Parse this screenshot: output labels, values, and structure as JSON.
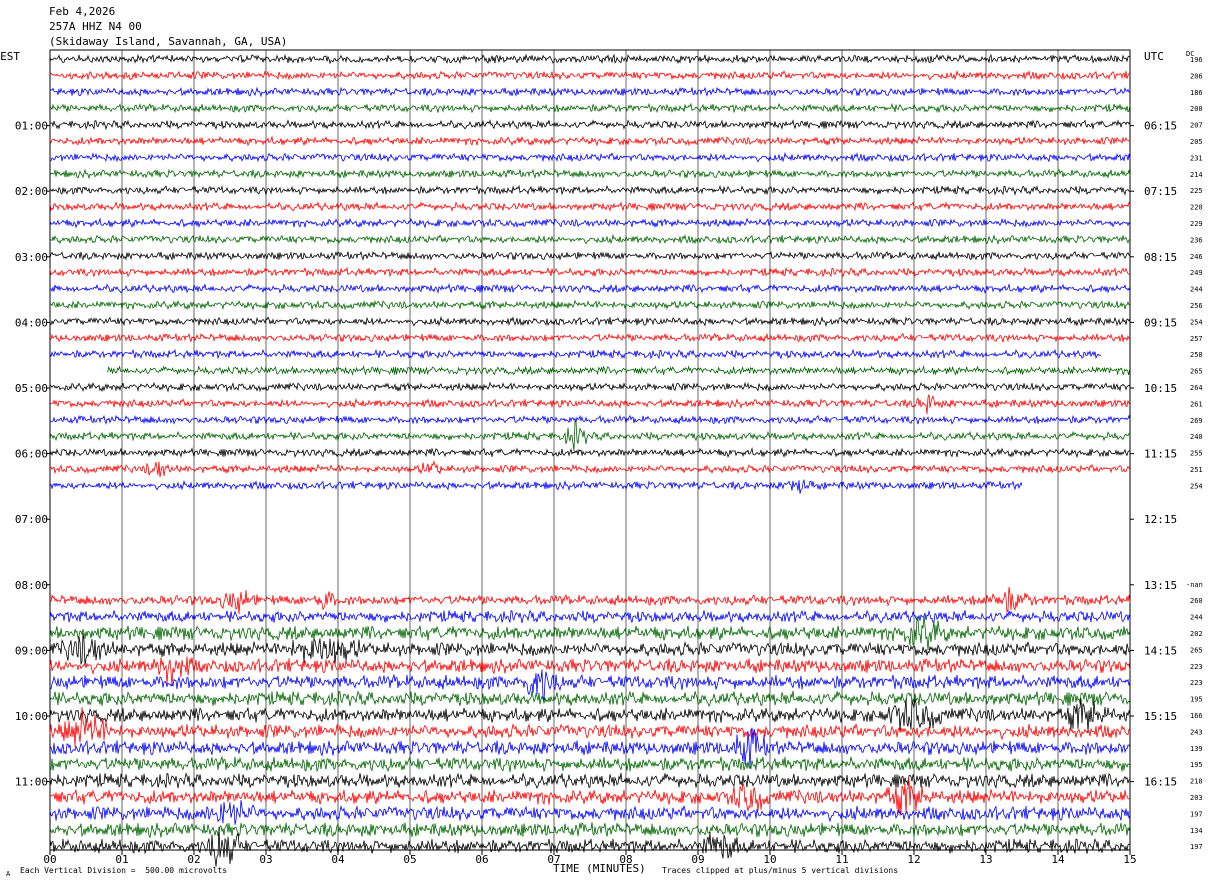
{
  "header": {
    "date": "Feb 4,2026",
    "station": "257A HHZ N4 00",
    "location": "(Skidaway Island, Savannah, GA, USA)"
  },
  "footer": {
    "scale_note": "Each Vertical Division =  500.00 microvolts",
    "clip_note": "Traces clipped at plus/minus 5 vertical divisions",
    "corner_mark": "A"
  },
  "chart_data": {
    "type": "line",
    "title": "",
    "xlabel": "TIME (MINUTES)",
    "x_ticks": [
      "00",
      "01",
      "02",
      "03",
      "04",
      "05",
      "06",
      "07",
      "08",
      "09",
      "10",
      "11",
      "12",
      "13",
      "14",
      "15"
    ],
    "xlim": [
      0,
      15
    ],
    "left_axis_label": "EST",
    "right_axis_label": "UTC",
    "dc_label": "DC",
    "left_time_labels": [
      "01:00",
      "02:00",
      "03:00",
      "04:00",
      "05:00",
      "06:00",
      "07:00",
      "08:00",
      "09:00",
      "10:00",
      "11:00"
    ],
    "right_time_labels": [
      "06:15",
      "07:15",
      "08:15",
      "09:15",
      "10:15",
      "11:15",
      "12:15",
      "13:15",
      "14:15",
      "15:15",
      "16:15"
    ],
    "colors": {
      "black": "#000000",
      "red": "#ff0000",
      "blue": "#0000ff",
      "green": "#006600"
    },
    "color_cycle": [
      "black",
      "red",
      "blue",
      "green"
    ],
    "grid": "vertical lines every minute",
    "gap_label": "-nan",
    "rows": [
      {
        "row": 0,
        "dc": "196",
        "start": 0,
        "end": 15,
        "amp": 1.0
      },
      {
        "row": 1,
        "dc": "206",
        "start": 0,
        "end": 15,
        "amp": 1.0
      },
      {
        "row": 2,
        "dc": "186",
        "start": 0,
        "end": 15,
        "amp": 1.0
      },
      {
        "row": 3,
        "dc": "200",
        "start": 0,
        "end": 15,
        "amp": 1.0
      },
      {
        "row": 4,
        "dc": "207",
        "start": 0,
        "end": 15,
        "amp": 1.0
      },
      {
        "row": 5,
        "dc": "205",
        "start": 0,
        "end": 15,
        "amp": 1.0
      },
      {
        "row": 6,
        "dc": "231",
        "start": 0,
        "end": 15,
        "amp": 1.0
      },
      {
        "row": 7,
        "dc": "214",
        "start": 0,
        "end": 15,
        "amp": 1.0
      },
      {
        "row": 8,
        "dc": "225",
        "start": 0,
        "end": 15,
        "amp": 1.0
      },
      {
        "row": 9,
        "dc": "220",
        "start": 0,
        "end": 15,
        "amp": 1.0
      },
      {
        "row": 10,
        "dc": "229",
        "start": 0,
        "end": 15,
        "amp": 1.0
      },
      {
        "row": 11,
        "dc": "236",
        "start": 0,
        "end": 15,
        "amp": 1.0
      },
      {
        "row": 12,
        "dc": "246",
        "start": 0,
        "end": 15,
        "amp": 1.0
      },
      {
        "row": 13,
        "dc": "249",
        "start": 0,
        "end": 15,
        "amp": 1.0
      },
      {
        "row": 14,
        "dc": "244",
        "start": 0,
        "end": 15,
        "amp": 1.0
      },
      {
        "row": 15,
        "dc": "256",
        "start": 0,
        "end": 15,
        "amp": 1.0
      },
      {
        "row": 16,
        "dc": "254",
        "start": 0,
        "end": 15,
        "amp": 1.0
      },
      {
        "row": 17,
        "dc": "257",
        "start": 0,
        "end": 15,
        "amp": 1.0
      },
      {
        "row": 18,
        "dc": "258",
        "start": 0,
        "end": 14.6,
        "amp": 1.0
      },
      {
        "row": 19,
        "dc": "265",
        "start": 0.8,
        "end": 15,
        "amp": 1.0
      },
      {
        "row": 20,
        "dc": "264",
        "start": 0,
        "end": 15,
        "amp": 1.0
      },
      {
        "row": 21,
        "dc": "261",
        "start": 0,
        "end": 15,
        "amp": 1.0
      },
      {
        "row": 22,
        "dc": "269",
        "start": 0,
        "end": 15,
        "amp": 1.0
      },
      {
        "row": 23,
        "dc": "240",
        "start": 0,
        "end": 15,
        "amp": 1.0
      },
      {
        "row": 24,
        "dc": "255",
        "start": 0,
        "end": 15,
        "amp": 1.0
      },
      {
        "row": 25,
        "dc": "251",
        "start": 0,
        "end": 15,
        "amp": 1.0
      },
      {
        "row": 26,
        "dc": "254",
        "start": 0,
        "end": 13.5,
        "amp": 1.0
      },
      {
        "row": 27,
        "dc": "",
        "start": 0,
        "end": 0,
        "amp": 0
      },
      {
        "row": 28,
        "dc": "",
        "start": 0,
        "end": 0,
        "amp": 0
      },
      {
        "row": 29,
        "dc": "",
        "start": 0,
        "end": 0,
        "amp": 0
      },
      {
        "row": 30,
        "dc": "",
        "start": 0,
        "end": 0,
        "amp": 0
      },
      {
        "row": 31,
        "dc": "",
        "start": 0,
        "end": 0,
        "amp": 0
      },
      {
        "row": 32,
        "dc": "-nan",
        "start": 0,
        "end": 0,
        "amp": 0
      },
      {
        "row": 33,
        "dc": "260",
        "start": 0,
        "end": 15,
        "amp": 1.3
      },
      {
        "row": 34,
        "dc": "244",
        "start": 0,
        "end": 15,
        "amp": 1.5
      },
      {
        "row": 35,
        "dc": "202",
        "start": 0,
        "end": 15,
        "amp": 1.8
      },
      {
        "row": 36,
        "dc": "265",
        "start": 0,
        "end": 15,
        "amp": 1.8
      },
      {
        "row": 37,
        "dc": "223",
        "start": 0,
        "end": 15,
        "amp": 1.8
      },
      {
        "row": 38,
        "dc": "223",
        "start": 0,
        "end": 15,
        "amp": 1.8
      },
      {
        "row": 39,
        "dc": "195",
        "start": 0,
        "end": 15,
        "amp": 1.8
      },
      {
        "row": 40,
        "dc": "166",
        "start": 0,
        "end": 15,
        "amp": 1.8
      },
      {
        "row": 41,
        "dc": "243",
        "start": 0,
        "end": 15,
        "amp": 1.8
      },
      {
        "row": 42,
        "dc": "139",
        "start": 0,
        "end": 15,
        "amp": 1.8
      },
      {
        "row": 43,
        "dc": "195",
        "start": 0,
        "end": 15,
        "amp": 1.8
      },
      {
        "row": 44,
        "dc": "218",
        "start": 0,
        "end": 15,
        "amp": 1.8
      },
      {
        "row": 45,
        "dc": "203",
        "start": 0,
        "end": 15,
        "amp": 1.8
      },
      {
        "row": 46,
        "dc": "197",
        "start": 0,
        "end": 15,
        "amp": 1.8
      },
      {
        "row": 47,
        "dc": "134",
        "start": 0,
        "end": 15,
        "amp": 1.8
      },
      {
        "row": 48,
        "dc": "197",
        "start": 0,
        "end": 15,
        "amp": 1.8
      }
    ],
    "events": [
      {
        "row": 21,
        "minute": 12.2,
        "amp": 3.5,
        "width": 0.2
      },
      {
        "row": 23,
        "minute": 7.3,
        "amp": 4,
        "width": 0.2
      },
      {
        "row": 25,
        "minute": 1.5,
        "amp": 3.5,
        "width": 0.2
      },
      {
        "row": 25,
        "minute": 5.3,
        "amp": 2.5,
        "width": 0.2
      },
      {
        "row": 26,
        "minute": 10.4,
        "amp": 3.5,
        "width": 0.2
      },
      {
        "row": 33,
        "minute": 2.6,
        "amp": 3,
        "width": 0.3
      },
      {
        "row": 33,
        "minute": 13.3,
        "amp": 3,
        "width": 0.4
      },
      {
        "row": 33,
        "minute": 3.8,
        "amp": 3,
        "width": 0.2
      },
      {
        "row": 35,
        "minute": 12.1,
        "amp": 3,
        "width": 0.4
      },
      {
        "row": 36,
        "minute": 0.5,
        "amp": 3,
        "width": 0.4
      },
      {
        "row": 36,
        "minute": 3.8,
        "amp": 3,
        "width": 0.6
      },
      {
        "row": 37,
        "minute": 1.7,
        "amp": 3.5,
        "width": 0.3
      },
      {
        "row": 38,
        "minute": 6.8,
        "amp": 3.5,
        "width": 0.3
      },
      {
        "row": 40,
        "minute": 12.0,
        "amp": 3,
        "width": 0.5
      },
      {
        "row": 40,
        "minute": 14.4,
        "amp": 3,
        "width": 0.4
      },
      {
        "row": 41,
        "minute": 0.5,
        "amp": 3.5,
        "width": 0.4
      },
      {
        "row": 42,
        "minute": 9.7,
        "amp": 3.5,
        "width": 0.3
      },
      {
        "row": 45,
        "minute": 9.7,
        "amp": 3,
        "width": 0.3
      },
      {
        "row": 45,
        "minute": 11.9,
        "amp": 3,
        "width": 0.4
      },
      {
        "row": 46,
        "minute": 2.5,
        "amp": 3,
        "width": 0.4
      },
      {
        "row": 48,
        "minute": 2.4,
        "amp": 4,
        "width": 0.3
      },
      {
        "row": 48,
        "minute": 9.3,
        "amp": 3,
        "width": 0.3
      }
    ]
  }
}
